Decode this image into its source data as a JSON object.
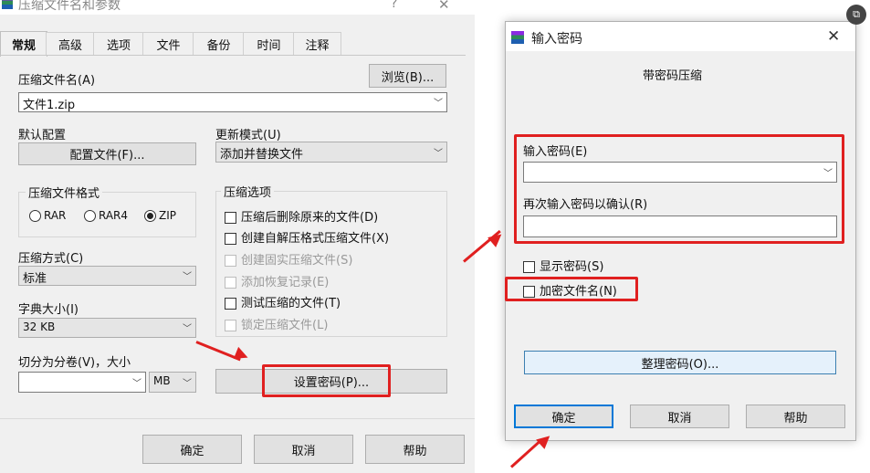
{
  "left_dialog": {
    "title": "压缩文件名和参数",
    "help_glyph": "?",
    "close_glyph": "✕",
    "tabs": [
      "常规",
      "高级",
      "选项",
      "文件",
      "备份",
      "时间",
      "注释"
    ],
    "archive_name_label": "压缩文件名(A)",
    "browse_label": "浏览(B)...",
    "archive_name_value": "文件1.zip",
    "default_profile_label": "默认配置",
    "profiles_button": "配置文件(F)...",
    "update_mode_label": "更新模式(U)",
    "update_mode_value": "添加并替换文件",
    "format_group_title": "压缩文件格式",
    "format_options": [
      "RAR",
      "RAR4",
      "ZIP"
    ],
    "format_selected": "ZIP",
    "method_label": "压缩方式(C)",
    "method_value": "标准",
    "dict_label": "字典大小(I)",
    "dict_value": "32 KB",
    "split_label": "切分为分卷(V)，大小",
    "split_unit": "MB",
    "options_group_title": "压缩选项",
    "options": [
      {
        "label": "压缩后删除原来的文件(D)",
        "disabled": false
      },
      {
        "label": "创建自解压格式压缩文件(X)",
        "disabled": false
      },
      {
        "label": "创建固实压缩文件(S)",
        "disabled": true
      },
      {
        "label": "添加恢复记录(E)",
        "disabled": true
      },
      {
        "label": "测试压缩的文件(T)",
        "disabled": false
      },
      {
        "label": "锁定压缩文件(L)",
        "disabled": true
      }
    ],
    "set_password_button": "设置密码(P)...",
    "ok": "确定",
    "cancel": "取消",
    "help": "帮助"
  },
  "right_dialog": {
    "title": "输入密码",
    "close_glyph": "✕",
    "subtitle": "带密码压缩",
    "password_label": "输入密码(E)",
    "confirm_label": "再次输入密码以确认(R)",
    "show_password_label": "显示密码(S)",
    "encrypt_names_label": "加密文件名(N)",
    "organize_button": "整理密码(O)...",
    "ok": "确定",
    "cancel": "取消",
    "help": "帮助"
  },
  "colors": {
    "highlight": "#e02020",
    "dialog_bg": "#f0f0f0",
    "focus": "#0078d7"
  }
}
